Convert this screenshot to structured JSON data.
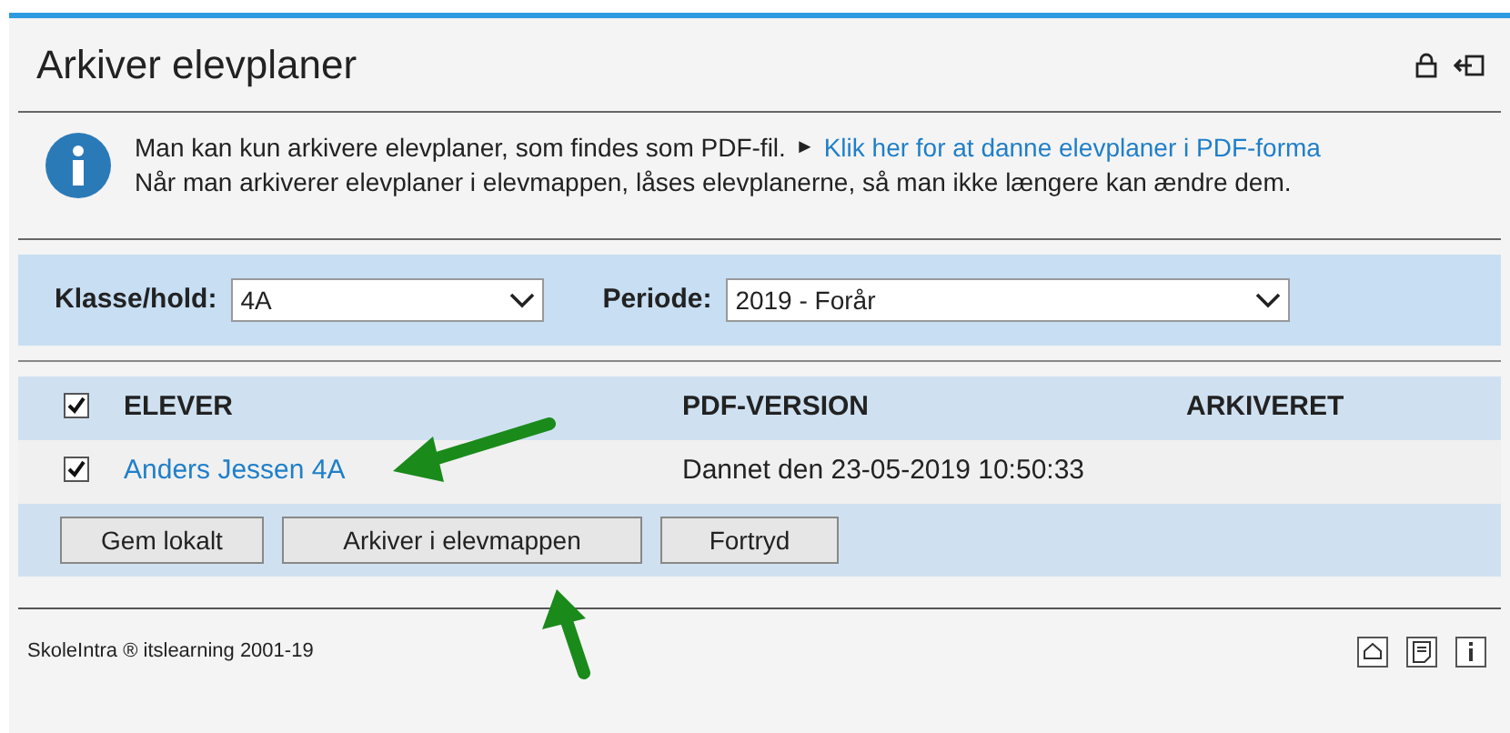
{
  "title": "Arkiver elevplaner",
  "info": {
    "line_1": "Man kan kun arkivere elevplaner, som findes som PDF-fil.",
    "link_marker": "►",
    "link": "Klik her for at danne elevplaner i PDF-forma",
    "line_2": "Når man arkiverer elevplaner i elevmappen, låses elevplanerne, så man ikke længere kan ændre dem."
  },
  "filters": [
    {
      "label": "Klasse/hold:",
      "value": "4A"
    },
    {
      "label": "Periode:",
      "value": "2019 - Forår"
    }
  ],
  "table": {
    "select_all_checked": true,
    "columns": [
      "ELEVER",
      "PDF-VERSION",
      "ARKIVERET"
    ],
    "rows": [
      {
        "checked": true,
        "student": "Anders Jessen 4A",
        "pdf_version": "Dannet den 23-05-2019 10:50:33"
      }
    ]
  },
  "buttons": [
    "Gem lokalt",
    "Arkiver i elevmappen",
    "Fortryd"
  ],
  "footer": "SkoleIntra ® itslearning 2001-19"
}
